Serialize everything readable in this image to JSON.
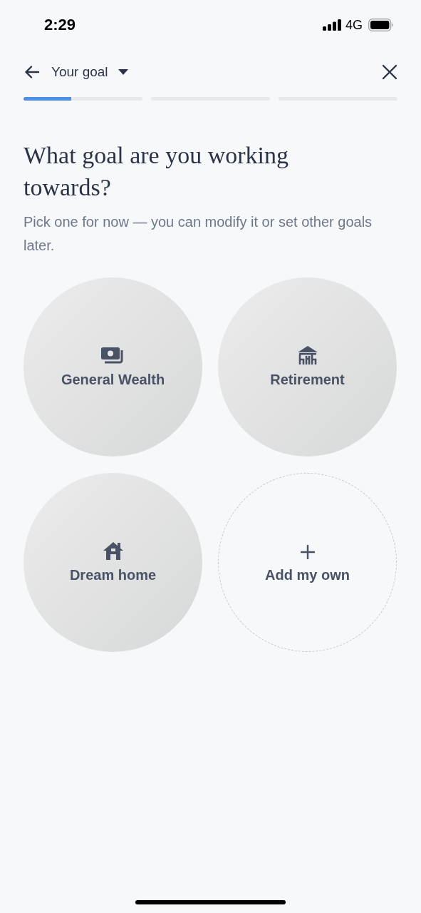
{
  "status_bar": {
    "time": "2:29",
    "network": "4G"
  },
  "header": {
    "title": "Your goal"
  },
  "progress": [
    {
      "level": 0.4
    },
    {
      "level": 0
    },
    {
      "level": 0
    }
  ],
  "heading": "What goal are you working towards?",
  "subtitle": "Pick one for now — you can modify it or set other goals later.",
  "goals": [
    {
      "kind": "option",
      "label": "General Wealth"
    },
    {
      "kind": "option",
      "label": "Retirement"
    },
    {
      "kind": "option",
      "label": "Dream home"
    },
    {
      "kind": "add",
      "label": "Add my own"
    }
  ]
}
